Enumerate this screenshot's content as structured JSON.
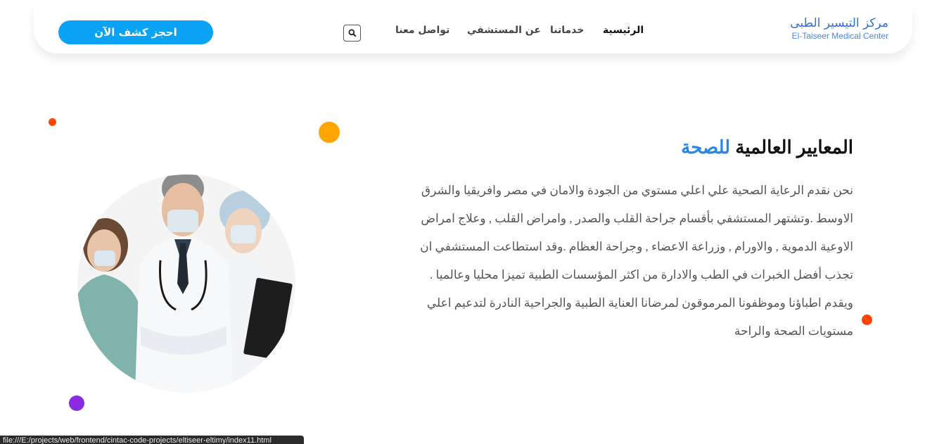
{
  "navbar": {
    "logo_ar": "مركز التيسير الطبى",
    "logo_en": "El-Taiseer Medical Center",
    "book_button": "احجز كشف الآن",
    "links": [
      {
        "label": "الرئيسية",
        "active": true
      },
      {
        "label": "خدماتنا",
        "active": false
      },
      {
        "label": "عن المستشفي",
        "active": false
      },
      {
        "label": "تواصل معنا",
        "active": false
      }
    ]
  },
  "hero": {
    "title_main": "المعايير العالمية",
    "title_highlight": "للصحة",
    "description": "نحن نقدم الرعاية الصحية علي اعلي مستوي من الجودة والامان في مصر وافريقيا والشرق الاوسط .وتشتهر المستشفي بأقسام جراحة القلب والصدر , وامراض القلب , وعلاج امراض الاوعية الدموية , والاورام , وزراعة الاعضاء , وجراحة العظام .وقد استطاعت المستشفي ان تجذب أفضل الخبرات في الطب والادارة من اكثر المؤسسات الطبية تميزا محليا وعالميا . ويقدم اطباؤنا وموظفونا المرموقون لمرضانا العناية الطبية والجراحية النادرة لتدعيم اعلي مستويات الصحة والراحة",
    "image_icon": "doctors-team-photo"
  },
  "colors": {
    "accent": "#0aa2f5",
    "title_highlight": "#2a86e4",
    "dot_orange": "#ffa500",
    "dot_red": "#ff4500",
    "dot_purple": "#8a2be2"
  },
  "status_bar": {
    "url": "file:///E:/projects/web/frontend/cintac-code-projects/eltiseer-eltimy/index11.html"
  }
}
